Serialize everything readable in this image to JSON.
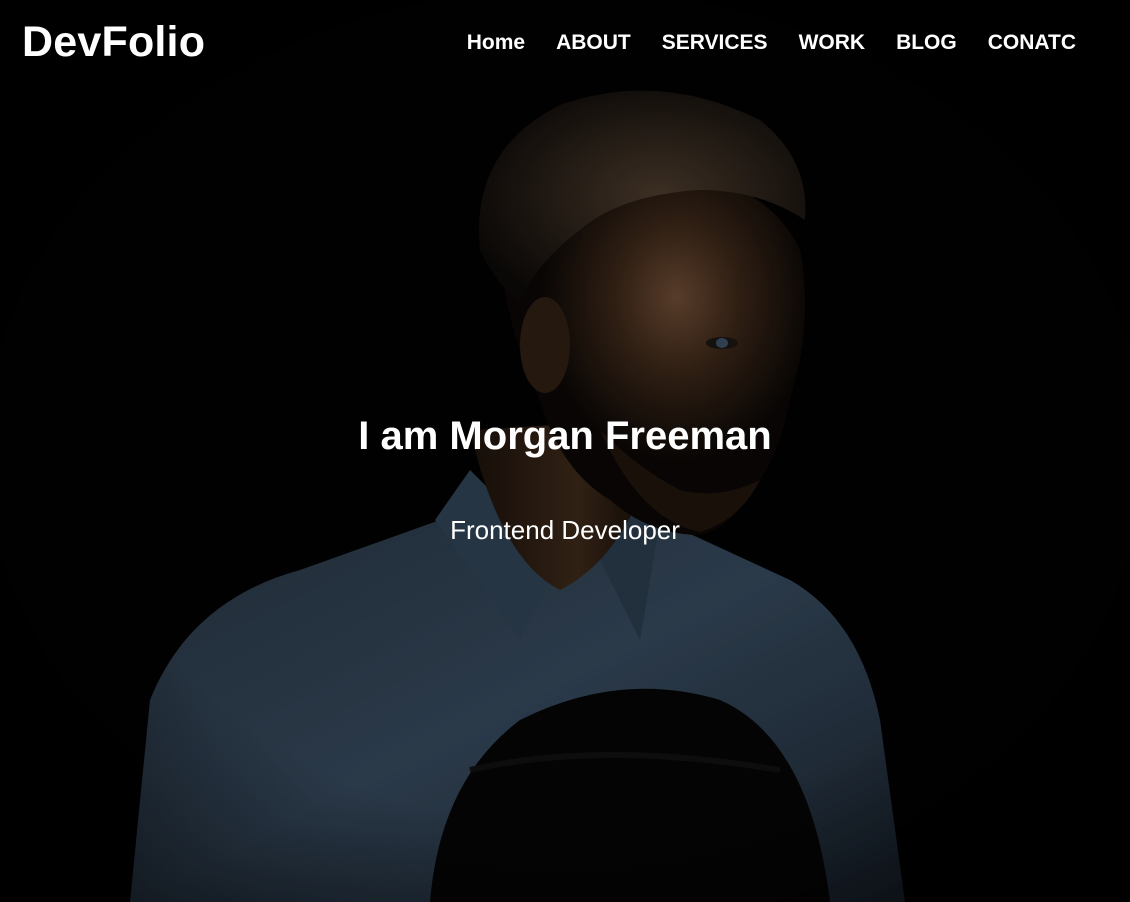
{
  "header": {
    "logo": "DevFolio",
    "nav": [
      {
        "label": "Home"
      },
      {
        "label": "ABOUT"
      },
      {
        "label": "SERVICES"
      },
      {
        "label": "WORK"
      },
      {
        "label": "BLOG"
      },
      {
        "label": "CONATC"
      }
    ]
  },
  "hero": {
    "title": "I am Morgan Freeman",
    "subtitle": "Frontend Developer"
  },
  "colors": {
    "background": "#000000",
    "text": "#ffffff",
    "shirt": "#2c3a48"
  },
  "icons": []
}
